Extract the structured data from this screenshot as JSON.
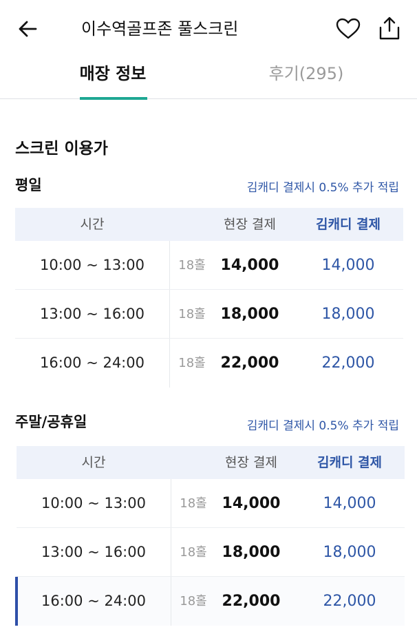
{
  "header": {
    "title": "이수역골프존 풀스크린",
    "back_icon": "arrow-left-icon",
    "favorite_icon": "heart-icon",
    "share_icon": "share-icon"
  },
  "tabs": [
    {
      "label": "매장 정보",
      "active": true
    },
    {
      "label": "후기(295)",
      "active": false
    }
  ],
  "section": {
    "title": "스크린 이용가"
  },
  "table_headers": {
    "time": "시간",
    "onsite": "현장 결제",
    "kim": "김캐디 결제"
  },
  "groups": [
    {
      "label": "평일",
      "notice": "김캐디 결제시 0.5% 추가 적립",
      "rows": [
        {
          "time": "10:00 ~ 13:00",
          "holes": "18홀",
          "onsite": "14,000",
          "kim": "14,000"
        },
        {
          "time": "13:00 ~ 16:00",
          "holes": "18홀",
          "onsite": "18,000",
          "kim": "18,000"
        },
        {
          "time": "16:00 ~ 24:00",
          "holes": "18홀",
          "onsite": "22,000",
          "kim": "22,000"
        }
      ]
    },
    {
      "label": "주말/공휴일",
      "notice": "김캐디 결제시 0.5% 추가 적립",
      "rows": [
        {
          "time": "10:00 ~ 13:00",
          "holes": "18홀",
          "onsite": "14,000",
          "kim": "14,000"
        },
        {
          "time": "13:00 ~ 16:00",
          "holes": "18홀",
          "onsite": "18,000",
          "kim": "18,000"
        },
        {
          "time": "16:00 ~ 24:00",
          "holes": "18홀",
          "onsite": "22,000",
          "kim": "22,000"
        }
      ]
    }
  ],
  "colors": {
    "accent_green": "#1ea793",
    "link_blue": "#2e56a6",
    "header_bg": "#eef2fa"
  }
}
